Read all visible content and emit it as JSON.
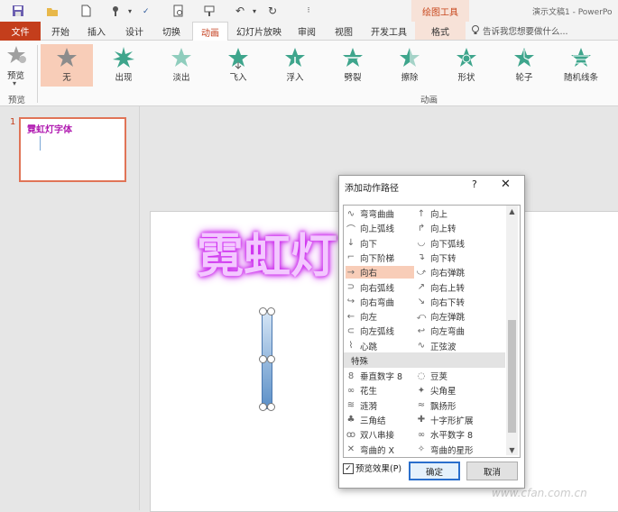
{
  "title_bar": {
    "drawing_tools": "绘图工具",
    "app_title": "演示文稿1 - PowerPo"
  },
  "tabs": [
    {
      "label": "文件"
    },
    {
      "label": "开始"
    },
    {
      "label": "插入"
    },
    {
      "label": "设计"
    },
    {
      "label": "切换"
    },
    {
      "label": "动画"
    },
    {
      "label": "幻灯片放映"
    },
    {
      "label": "审阅"
    },
    {
      "label": "视图"
    },
    {
      "label": "开发工具"
    },
    {
      "label": "格式"
    }
  ],
  "tell_me": "告诉我您想要做什么...",
  "ribbon": {
    "preview_label": "预览",
    "preview_group": "预览",
    "animation_group": "动画",
    "animations": [
      {
        "label": "无"
      },
      {
        "label": "出现"
      },
      {
        "label": "淡出"
      },
      {
        "label": "飞入"
      },
      {
        "label": "浮入"
      },
      {
        "label": "劈裂"
      },
      {
        "label": "擦除"
      },
      {
        "label": "形状"
      },
      {
        "label": "轮子"
      },
      {
        "label": "随机线条"
      }
    ],
    "colors": {
      "accent": "#c43e1c",
      "star_green": "#3ea58c",
      "star_gray": "#8c8c8c",
      "selected": "#f8cdb8"
    }
  },
  "slides": {
    "number": "1",
    "thumbnail_title": "霓虹灯字体"
  },
  "canvas": {
    "neon_text": "霓虹灯",
    "neon_color": "#c41be8",
    "watermark": "www.cfan.com.cn"
  },
  "dialog": {
    "title": "添加动作路径",
    "help": "?",
    "close": "✕",
    "items": [
      {
        "label": "弯弯曲曲",
        "icon": "wave-icon"
      },
      {
        "label": "向上",
        "icon": "arrow-up-icon"
      },
      {
        "label": "向上弧线",
        "icon": "arc-up-icon"
      },
      {
        "label": "向上转",
        "icon": "turn-up-icon"
      },
      {
        "label": "向下",
        "icon": "arrow-down-icon"
      },
      {
        "label": "向下弧线",
        "icon": "arc-down-icon"
      },
      {
        "label": "向下阶梯",
        "icon": "stairs-down-icon"
      },
      {
        "label": "向下转",
        "icon": "turn-down-icon"
      },
      {
        "label": "向右",
        "icon": "arrow-right-icon"
      },
      {
        "label": "向右弹跳",
        "icon": "bounce-right-icon"
      },
      {
        "label": "向右弧线",
        "icon": "arc-right-icon"
      },
      {
        "label": "向右上转",
        "icon": "turn-right-up-icon"
      },
      {
        "label": "向右弯曲",
        "icon": "curve-right-icon"
      },
      {
        "label": "向右下转",
        "icon": "turn-right-down-icon"
      },
      {
        "label": "向左",
        "icon": "arrow-left-icon"
      },
      {
        "label": "向左弹跳",
        "icon": "bounce-left-icon"
      },
      {
        "label": "向左弧线",
        "icon": "arc-left-icon"
      },
      {
        "label": "向左弯曲",
        "icon": "curve-left-icon"
      },
      {
        "label": "心跳",
        "icon": "heartbeat-icon"
      },
      {
        "label": "正弦波",
        "icon": "sine-wave-icon"
      }
    ],
    "category_special": "特殊",
    "special_items": [
      {
        "label": "垂直数字 8",
        "icon": "figure8-vertical-icon"
      },
      {
        "label": "豆荚",
        "icon": "bean-icon"
      },
      {
        "label": "花生",
        "icon": "peanut-icon"
      },
      {
        "label": "尖角星",
        "icon": "pointy-star-icon"
      },
      {
        "label": "涟漪",
        "icon": "ripple-icon"
      },
      {
        "label": "飘扬形",
        "icon": "flutter-icon"
      },
      {
        "label": "三角结",
        "icon": "trefoil-icon"
      },
      {
        "label": "十字形扩展",
        "icon": "cross-expand-icon"
      },
      {
        "label": "双八串接",
        "icon": "double-eight-icon"
      },
      {
        "label": "水平数字 8",
        "icon": "figure8-horizontal-icon"
      },
      {
        "label": "弯曲的 X",
        "icon": "curved-x-icon"
      },
      {
        "label": "弯曲的星形",
        "icon": "curved-star-icon"
      }
    ],
    "selected_item": "向右",
    "preview_effect": "预览效果(P)",
    "preview_checked": "✓",
    "ok": "确定",
    "cancel": "取消"
  }
}
